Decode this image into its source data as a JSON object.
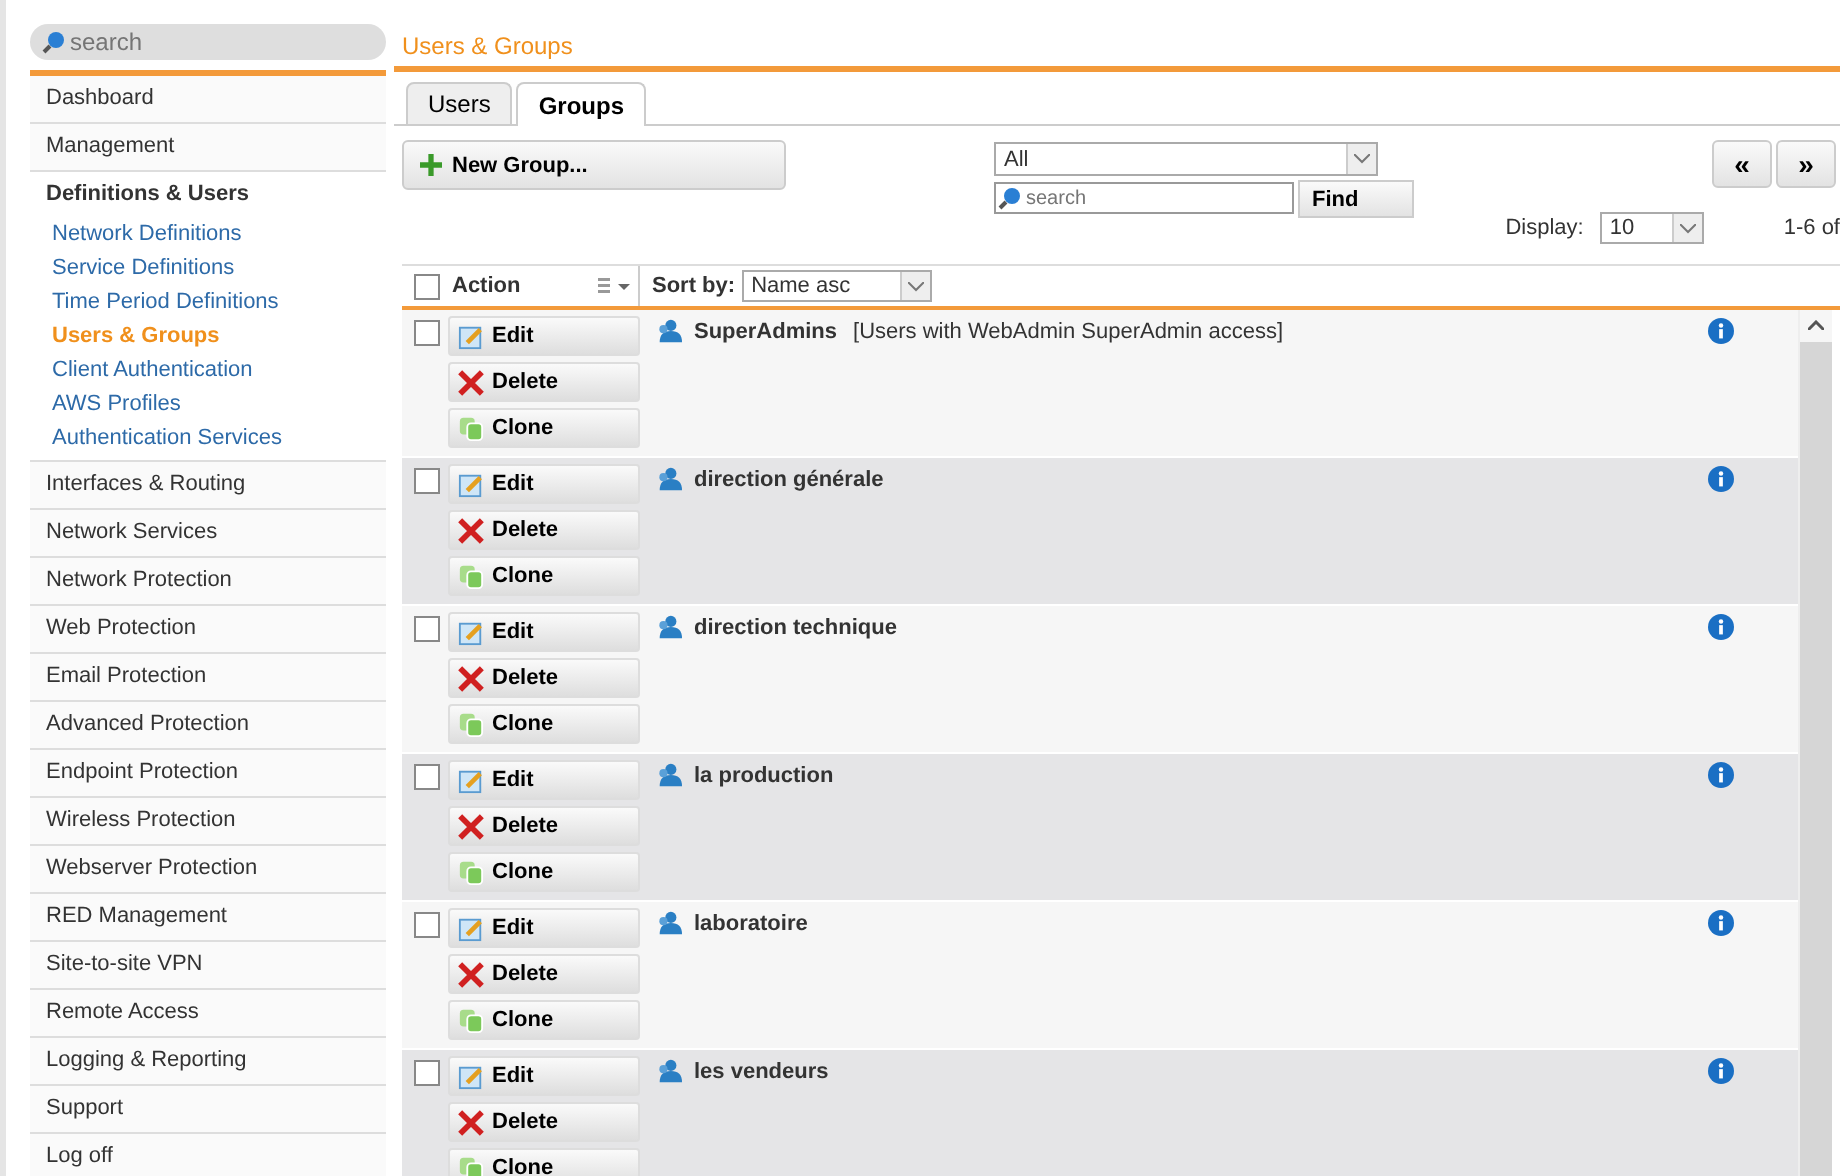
{
  "sidebar": {
    "search": {
      "placeholder": "search"
    },
    "items": [
      {
        "label": "Dashboard"
      },
      {
        "label": "Management"
      },
      {
        "label": "Definitions & Users",
        "expanded": true,
        "children": [
          {
            "label": "Network Definitions",
            "selected": false
          },
          {
            "label": "Service Definitions",
            "selected": false
          },
          {
            "label": "Time Period Definitions",
            "selected": false
          },
          {
            "label": "Users & Groups",
            "selected": true
          },
          {
            "label": "Client Authentication",
            "selected": false
          },
          {
            "label": "AWS Profiles",
            "selected": false
          },
          {
            "label": "Authentication Services",
            "selected": false
          }
        ]
      },
      {
        "label": "Interfaces & Routing"
      },
      {
        "label": "Network Services"
      },
      {
        "label": "Network Protection"
      },
      {
        "label": "Web Protection"
      },
      {
        "label": "Email Protection"
      },
      {
        "label": "Advanced Protection"
      },
      {
        "label": "Endpoint Protection"
      },
      {
        "label": "Wireless Protection"
      },
      {
        "label": "Webserver Protection"
      },
      {
        "label": "RED Management"
      },
      {
        "label": "Site-to-site VPN"
      },
      {
        "label": "Remote Access"
      },
      {
        "label": "Logging & Reporting"
      },
      {
        "label": "Support"
      },
      {
        "label": "Log off"
      }
    ]
  },
  "breadcrumb": "Users & Groups",
  "tabs": [
    {
      "label": "Users",
      "selected": false
    },
    {
      "label": "Groups",
      "selected": true
    }
  ],
  "toolbar": {
    "new_button": "New Group...",
    "filter": "All",
    "search": {
      "placeholder": "search"
    },
    "find_button": "Find",
    "display_label": "Display:",
    "display_value": "10",
    "prev": "«",
    "next": "»",
    "range": "1-6 of"
  },
  "table": {
    "action_header": "Action",
    "sort_label": "Sort by:",
    "sort_value": "Name asc",
    "header_checked": false,
    "rows": [
      {
        "name": "SuperAdmins",
        "description": "[Users with WebAdmin SuperAdmin access]",
        "checked": false,
        "actions": [
          {
            "kind": "edit",
            "label": "Edit"
          },
          {
            "kind": "delete",
            "label": "Delete"
          },
          {
            "kind": "clone",
            "label": "Clone"
          }
        ]
      },
      {
        "name": "direction générale",
        "checked": false,
        "actions": [
          {
            "kind": "edit",
            "label": "Edit"
          },
          {
            "kind": "delete",
            "label": "Delete"
          },
          {
            "kind": "clone",
            "label": "Clone"
          }
        ]
      },
      {
        "name": "direction technique",
        "checked": false,
        "actions": [
          {
            "kind": "edit",
            "label": "Edit"
          },
          {
            "kind": "delete",
            "label": "Delete"
          },
          {
            "kind": "clone",
            "label": "Clone"
          }
        ]
      },
      {
        "name": "la production",
        "checked": false,
        "actions": [
          {
            "kind": "edit",
            "label": "Edit"
          },
          {
            "kind": "delete",
            "label": "Delete"
          },
          {
            "kind": "clone",
            "label": "Clone"
          }
        ]
      },
      {
        "name": "laboratoire",
        "checked": false,
        "actions": [
          {
            "kind": "edit",
            "label": "Edit"
          },
          {
            "kind": "delete",
            "label": "Delete"
          },
          {
            "kind": "clone",
            "label": "Clone"
          }
        ]
      },
      {
        "name": "les vendeurs",
        "checked": false,
        "actions": [
          {
            "kind": "edit",
            "label": "Edit"
          },
          {
            "kind": "delete",
            "label": "Delete"
          },
          {
            "kind": "clone",
            "label": "Clone"
          }
        ]
      }
    ]
  }
}
